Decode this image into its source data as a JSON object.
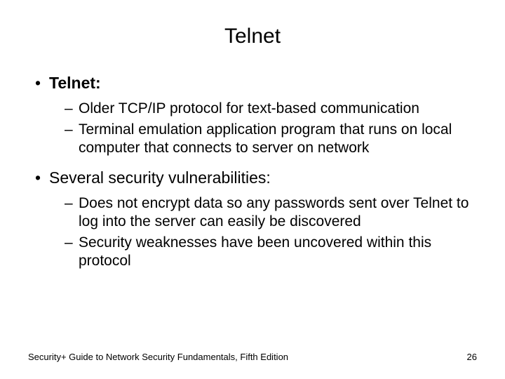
{
  "title": "Telnet",
  "bullets": {
    "b1": "Telnet:",
    "b1_sub1": "Older TCP/IP protocol for text-based communication",
    "b1_sub2": "Terminal emulation application program that runs on local computer that connects to server on network",
    "b2": "Several security vulnerabilities:",
    "b2_sub1": "Does not encrypt data so any passwords sent over Telnet to log into the server can easily be discovered",
    "b2_sub2": "Security weaknesses have been uncovered within this protocol"
  },
  "footer": {
    "left": "Security+ Guide to Network Security Fundamentals, Fifth Edition",
    "right": "26"
  }
}
